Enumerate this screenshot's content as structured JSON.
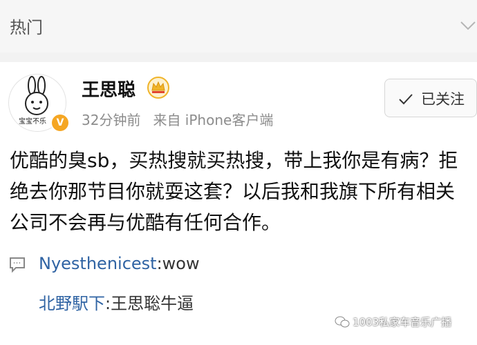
{
  "header": {
    "title": "热门",
    "chevron_icon": "chevron-down-icon"
  },
  "post": {
    "username": "王思聪",
    "avatar_caption": "宝宝不乐",
    "verified_badge": "V",
    "time": "32分钟前",
    "source": "来自 iPhone客户端",
    "follow_label": "已关注",
    "text": "优酷的臭sb，买热搜就买热搜，带上我你是有病？拒绝去你那节目你就耍这套？以后我和我旗下所有相关公司不会再与优酷有任何合作。"
  },
  "comments": [
    {
      "user": "Nyesthenicest",
      "sep": ":",
      "text": "wow"
    },
    {
      "user": "北野駅下",
      "sep": ":",
      "text": "王思聡牛逼"
    }
  ],
  "watermark": {
    "text": "1003私家车音乐广播"
  },
  "colors": {
    "link": "#2f63a3",
    "badge": "#f5a623",
    "crown": "#f0b429"
  }
}
